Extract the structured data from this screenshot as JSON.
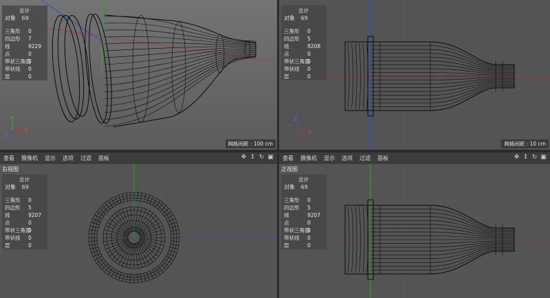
{
  "viewports": {
    "persp": {
      "stats": {
        "total": "总计",
        "objects_label": "对象",
        "objects": "69",
        "rows": [
          {
            "k": "三角形",
            "v": "0"
          },
          {
            "k": "四边形",
            "v": "7"
          },
          {
            "k": "线",
            "v": "9229"
          },
          {
            "k": "点",
            "v": "0"
          },
          {
            "k": "带状三角面",
            "v": "0"
          },
          {
            "k": "带状线",
            "v": "0"
          },
          {
            "k": "层",
            "v": "0"
          }
        ]
      },
      "grid_spacing": "网格间距 : 100 cm"
    },
    "top": {
      "stats": {
        "total": "总计",
        "objects_label": "对象",
        "objects": "69",
        "rows": [
          {
            "k": "三角形",
            "v": "0"
          },
          {
            "k": "四边形",
            "v": "5"
          },
          {
            "k": "线",
            "v": "9208"
          },
          {
            "k": "点",
            "v": "0"
          },
          {
            "k": "带状三角面",
            "v": "0"
          },
          {
            "k": "带状线",
            "v": "0"
          },
          {
            "k": "层",
            "v": "0"
          }
        ]
      },
      "grid_spacing": "网格间距 : 10 cm"
    },
    "right": {
      "title": "右视图",
      "menu": [
        "查看",
        "摄像机",
        "显示",
        "选项",
        "过滤",
        "面板"
      ],
      "stats": {
        "total": "总计",
        "objects_label": "对象",
        "objects": "69",
        "rows": [
          {
            "k": "三角形",
            "v": "0"
          },
          {
            "k": "四边形",
            "v": "5"
          },
          {
            "k": "线",
            "v": "9207"
          },
          {
            "k": "点",
            "v": "0"
          },
          {
            "k": "带状三角面",
            "v": "0"
          },
          {
            "k": "带状线",
            "v": "0"
          },
          {
            "k": "层",
            "v": "0"
          }
        ]
      }
    },
    "front": {
      "title": "正视图",
      "menu": [
        "查看",
        "摄像机",
        "显示",
        "选项",
        "过滤",
        "面板"
      ],
      "stats": {
        "total": "总计",
        "objects_label": "对象",
        "objects": "69",
        "rows": [
          {
            "k": "三角形",
            "v": "0"
          },
          {
            "k": "四边形",
            "v": "5"
          },
          {
            "k": "线",
            "v": "9207"
          },
          {
            "k": "点",
            "v": "0"
          },
          {
            "k": "带状三角面",
            "v": "0"
          },
          {
            "k": "带状线",
            "v": "0"
          },
          {
            "k": "层",
            "v": "0"
          }
        ]
      }
    }
  },
  "axis_labels": {
    "x": "X",
    "y": "Y",
    "z": "Z"
  },
  "nav_icons": [
    "move-view-icon",
    "zoom-view-icon",
    "rotate-view-icon",
    "maximize-view-icon"
  ],
  "colors": {
    "viewport_bg": "#545454",
    "persp_bg": "#6a6a6a",
    "grid": "#5e5e5e",
    "x_axis": "#c03030",
    "y_axis": "#30b030",
    "z_axis": "#3050d0",
    "wire": "#0a0a0a"
  }
}
